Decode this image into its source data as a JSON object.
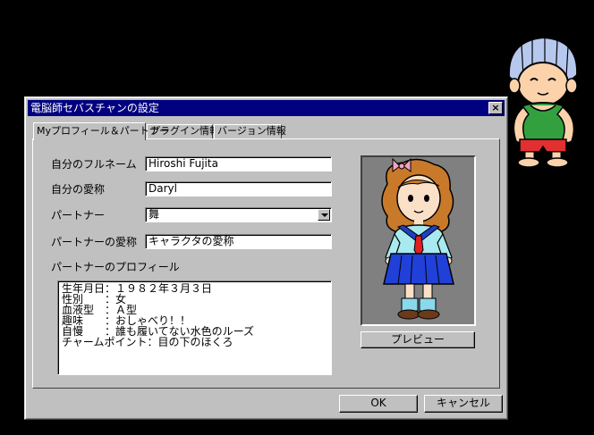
{
  "window": {
    "title": "電脳師セバスチャンの設定",
    "close_label": "×"
  },
  "tabs": [
    {
      "label": "Myプロフィール＆パートナー"
    },
    {
      "label": "プラグイン情報"
    },
    {
      "label": "バージョン情報"
    }
  ],
  "form": {
    "fullname_label": "自分のフルネーム",
    "fullname_value": "Hiroshi Fujita",
    "nickname_label": "自分の愛称",
    "nickname_value": "Daryl",
    "partner_label": "パートナー",
    "partner_value": "舞",
    "partner_nickname_label": "パートナーの愛称",
    "partner_nickname_value": "キャラクタの愛称",
    "profile_label": "パートナーのプロフィール",
    "profile_lines": [
      "生年月日：１９８２年３月３日",
      "性別　　：女",
      "血液型　：Ａ型",
      "趣味　　：おしゃべり！！",
      "自慢　　：誰も履いてない水色のルーズ",
      "チャームポイント：目の下のほくろ"
    ]
  },
  "buttons": {
    "preview": "プレビュー",
    "ok": "OK",
    "cancel": "キャンセル"
  },
  "icons": {
    "character": "schoolgirl-portrait",
    "mascot": "sebastian-mascot-icon"
  }
}
